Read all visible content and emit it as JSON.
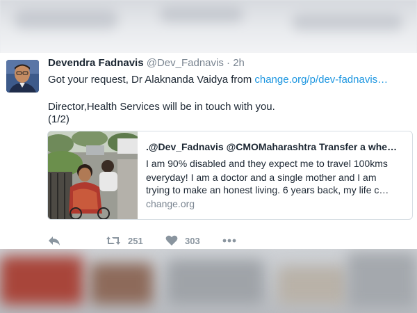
{
  "tweet": {
    "author_name": "Devendra Fadnavis",
    "author_handle": "@Dev_Fadnavis",
    "separator": "·",
    "time": "2h",
    "line1_text": "Got your request, Dr Alaknanda Vaidya from ",
    "line1_link": "change.org/p/dev-fadnavis…",
    "line2": "Director,Health Services will be in touch with you.",
    "line3": "(1/2)"
  },
  "card": {
    "title": ".@Dev_Fadnavis @CMOMaharashtra Transfer a whe…",
    "description_lines": [
      "I am 90% disabled and they expect me to travel 100kms",
      "everyday! I am a doctor and a single mother and I am",
      " trying to make an honest living. 6 years back, my life c…"
    ],
    "domain": "change.org"
  },
  "actions": {
    "reply_icon": "reply-icon",
    "retweet_icon": "retweet-icon",
    "retweet_count": "251",
    "like_icon": "heart-icon",
    "like_count": "303",
    "more_icon": "more-dots-icon"
  },
  "colors": {
    "link": "#1b95e0",
    "text": "#1c2733",
    "muted": "#7a8591",
    "action": "#8a959f"
  }
}
